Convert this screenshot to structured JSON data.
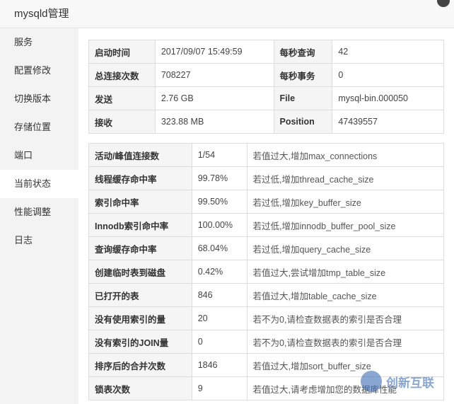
{
  "window": {
    "title": "mysqld管理"
  },
  "sidebar": {
    "items": [
      {
        "label": "服务"
      },
      {
        "label": "配置修改"
      },
      {
        "label": "切换版本"
      },
      {
        "label": "存储位置"
      },
      {
        "label": "端口"
      },
      {
        "label": "当前状态"
      },
      {
        "label": "性能调整"
      },
      {
        "label": "日志"
      }
    ],
    "active_index": 5
  },
  "summary": {
    "rows": [
      {
        "k1": "启动时间",
        "v1": "2017/09/07 15:49:59",
        "k2": "每秒查询",
        "v2": "42"
      },
      {
        "k1": "总连接次数",
        "v1": "708227",
        "k2": "每秒事务",
        "v2": "0"
      },
      {
        "k1": "发送",
        "v1": "2.76 GB",
        "k2": "File",
        "v2": "mysql-bin.000050"
      },
      {
        "k1": "接收",
        "v1": "323.88 MB",
        "k2": "Position",
        "v2": "47439557"
      }
    ]
  },
  "metrics": {
    "rows": [
      {
        "name": "活动/峰值连接数",
        "value": "1/54",
        "tip": "若值过大,增加max_connections"
      },
      {
        "name": "线程缓存命中率",
        "value": "99.78%",
        "tip": "若过低,增加thread_cache_size"
      },
      {
        "name": "索引命中率",
        "value": "99.50%",
        "tip": "若过低,增加key_buffer_size"
      },
      {
        "name": "Innodb索引命中率",
        "value": "100.00%",
        "tip": "若过低,增加innodb_buffer_pool_size"
      },
      {
        "name": "查询缓存命中率",
        "value": "68.04%",
        "tip": "若过低,增加query_cache_size"
      },
      {
        "name": "创建临时表到磁盘",
        "value": "0.42%",
        "tip": "若值过大,尝试增加tmp_table_size"
      },
      {
        "name": "已打开的表",
        "value": "846",
        "tip": "若值过大,增加table_cache_size"
      },
      {
        "name": "没有使用索引的量",
        "value": "20",
        "tip": "若不为0,请检查数据表的索引是否合理"
      },
      {
        "name": "没有索引的JOIN量",
        "value": "0",
        "tip": "若不为0,请检查数据表的索引是否合理"
      },
      {
        "name": "排序后的合并次数",
        "value": "1846",
        "tip": "若值过大,增加sort_buffer_size"
      },
      {
        "name": "锁表次数",
        "value": "9",
        "tip": "若值过大,请考虑增加您的数据库性能"
      }
    ]
  },
  "watermark": {
    "text": "创新互联",
    "icon": "brand-logo-icon"
  }
}
